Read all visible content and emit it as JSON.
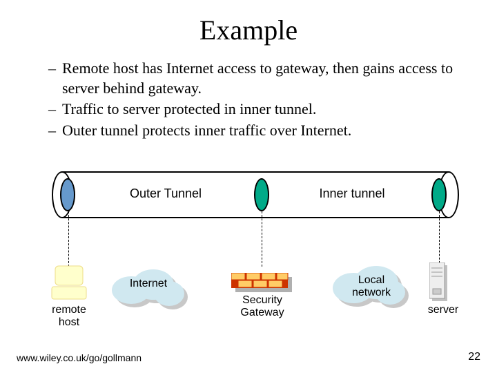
{
  "title": "Example",
  "bullets": [
    "Remote host has Internet access to gateway, then gains access to server behind gateway.",
    "Traffic to server protected in inner tunnel.",
    "Outer tunnel protects inner traffic over Internet."
  ],
  "labels": {
    "outer_tunnel": "Outer Tunnel",
    "inner_tunnel": "Inner tunnel",
    "internet": "Internet",
    "security_gateway": "Security Gateway",
    "local_network": "Local network",
    "remote_host": "remote host",
    "server": "server"
  },
  "footer": {
    "url": "www.wiley.co.uk/go/gollmann",
    "page": "22"
  },
  "colors": {
    "outer_cap": "#6699cc",
    "inner_cap": "#00aa88",
    "host_fill": "#ffffcc",
    "server_fill": "#eeeeee",
    "cloud_fill": "#d0e8f0",
    "firewall_red": "#cc3300",
    "firewall_yellow": "#ffcc66"
  }
}
